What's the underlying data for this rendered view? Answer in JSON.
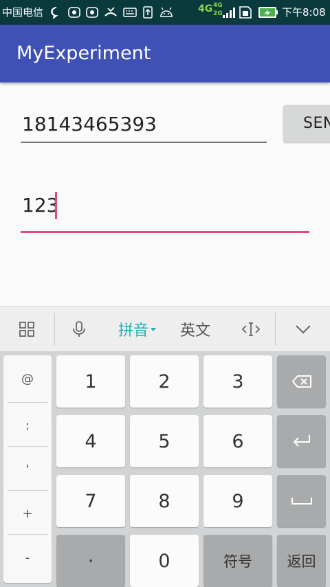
{
  "status_bar": {
    "carrier": "中国电信",
    "net_primary": "4G",
    "net_secondary_top": "4G",
    "net_secondary_bottom": "2G",
    "time": "下午8:08",
    "icons": [
      "chat-icon",
      "huawei-icon",
      "huawei-icon",
      "missed-call-icon",
      "keyboard-icon",
      "upload-icon",
      "android-icon",
      "signal-icon",
      "sim-icon",
      "battery-charging-icon"
    ]
  },
  "app": {
    "title": "MyExperiment"
  },
  "form": {
    "phone_value": "18143465393",
    "send_label": "SEND",
    "message_value": "123"
  },
  "keyboard": {
    "toolbar": {
      "pinyin": "拼音",
      "english": "英文"
    },
    "side_keys": [
      "@",
      ":",
      "'",
      "+",
      "-"
    ],
    "keys": {
      "k1": "1",
      "k2": "2",
      "k3": "3",
      "k4": "4",
      "k5": "5",
      "k6": "6",
      "k7": "7",
      "k8": "8",
      "k9": "9",
      "dot": "·",
      "k0": "0",
      "symbols": "符号",
      "back": "返回"
    }
  },
  "colors": {
    "app_bar": "#3f51b5",
    "accent": "#e8467e",
    "ime_active": "#1fb0b7",
    "status_bar": "#0b3a3e"
  }
}
